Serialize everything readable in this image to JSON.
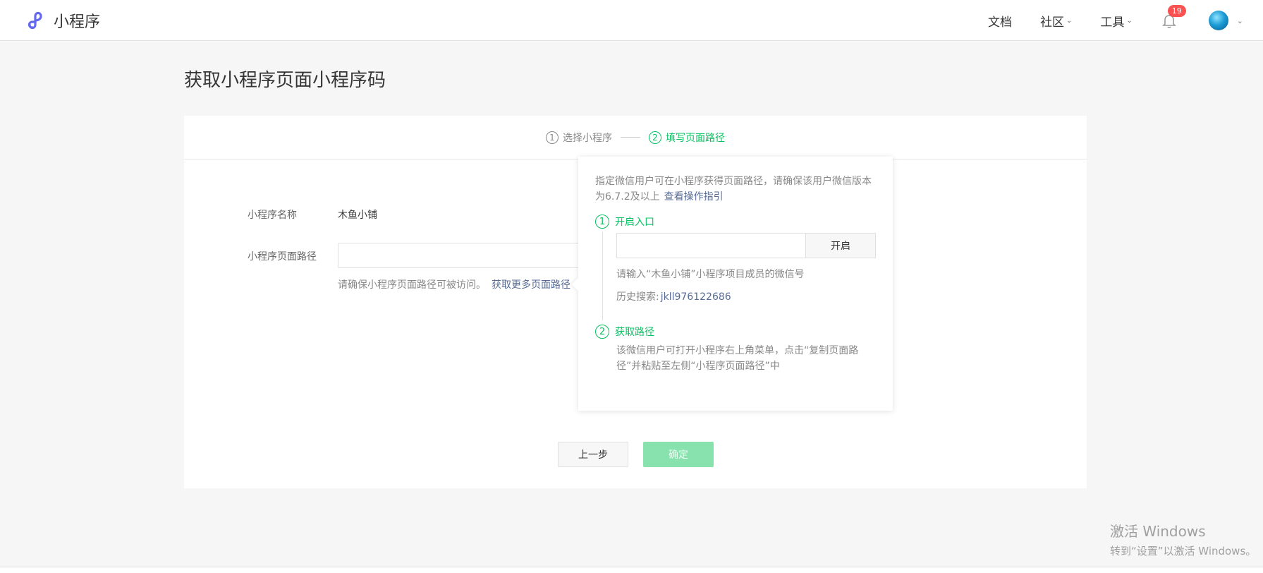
{
  "header": {
    "logo_text": "小程序",
    "nav": [
      {
        "label": "文档"
      },
      {
        "label": "社区",
        "chevron": true
      },
      {
        "label": "工具",
        "chevron": true
      }
    ],
    "notifications": {
      "count": "19",
      "icon": "bell-icon"
    },
    "avatar_icon": "avatar"
  },
  "page": {
    "title": "获取小程序页面小程序码"
  },
  "steps": [
    {
      "num": "1",
      "label": "选择小程序",
      "active": false
    },
    {
      "num": "2",
      "label": "填写页面路径",
      "active": true
    }
  ],
  "form": {
    "name_label": "小程序名称",
    "name_value": "木鱼小铺",
    "path_label": "小程序页面路径",
    "path_value": "",
    "hint_text": "请确保小程序页面路径可被访问。",
    "hint_link": "获取更多页面路径"
  },
  "buttons": {
    "prev": "上一步",
    "confirm": "确定"
  },
  "popover": {
    "desc": "指定微信用户可在小程序获得页面路径，请确保该用户微信版本为6.7.2及以上",
    "desc_link": "查看操作指引",
    "step1": {
      "num": "1",
      "title": "开启入口",
      "input_value": "",
      "button": "开启",
      "hint": "请输入“木鱼小铺”小程序项目成员的微信号",
      "history_label": "历史搜索:",
      "history_value": "jkll976122686"
    },
    "step2": {
      "num": "2",
      "title": "获取路径",
      "text": "该微信用户可打开小程序右上角菜单，点击“复制页面路径”并粘贴至左侧“小程序页面路径”中"
    }
  },
  "watermark": {
    "line1": "激活 Windows",
    "line2": "转到“设置”以激活 Windows。"
  },
  "colors": {
    "accent": "#07c160",
    "link": "#576b95",
    "confirm_disabled": "#87e2ae",
    "badge": "#fa5151"
  }
}
